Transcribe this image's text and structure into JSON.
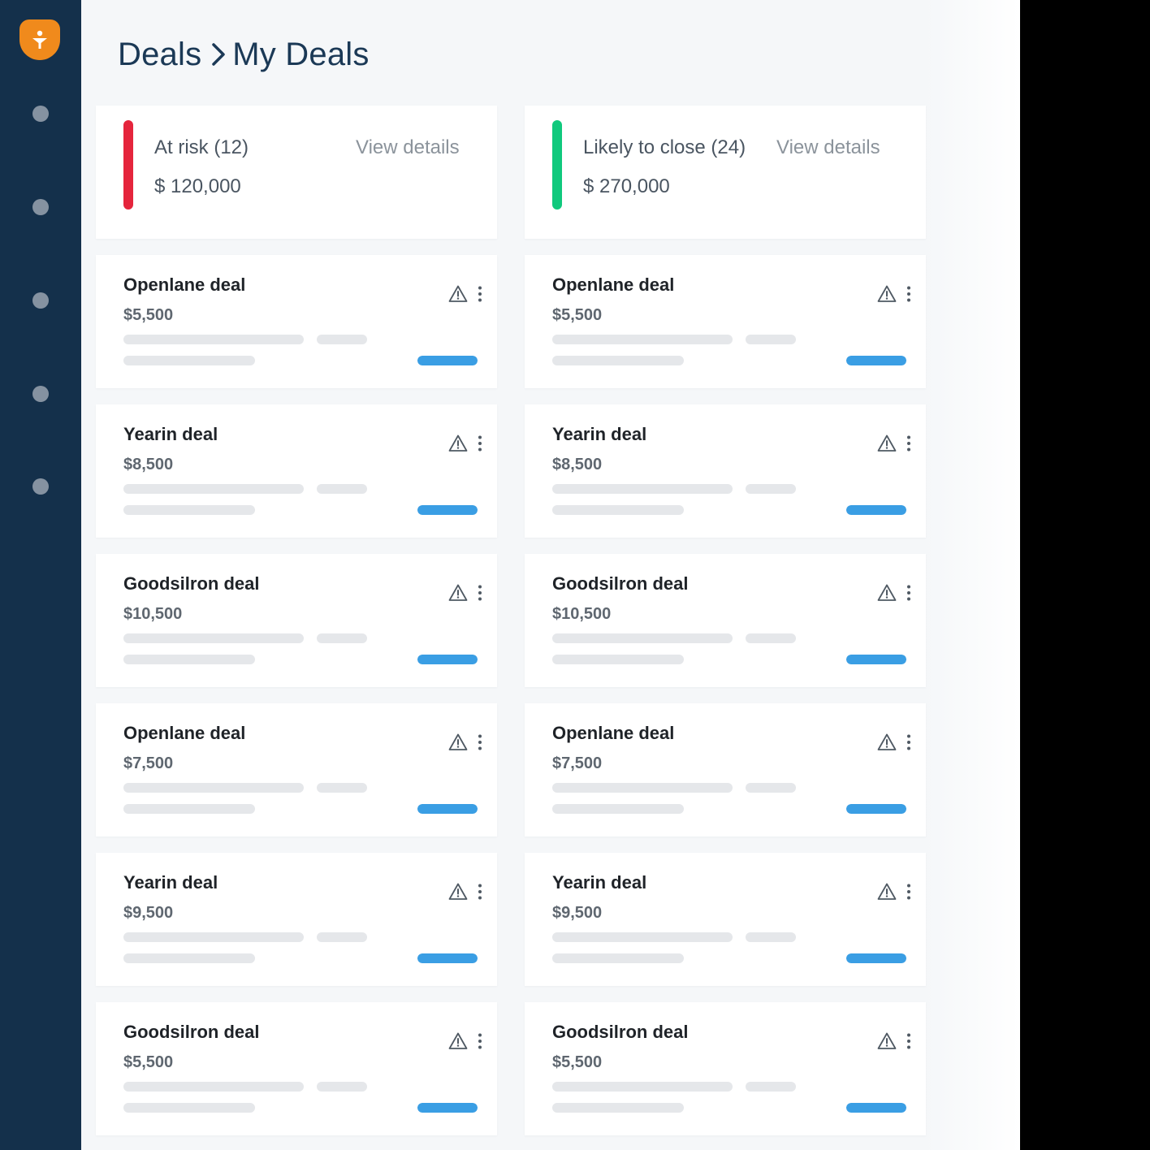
{
  "sidebar": {
    "nav_items": [
      "nav-item-1",
      "nav-item-2",
      "nav-item-3",
      "nav-item-4",
      "nav-item-5"
    ]
  },
  "breadcrumb": {
    "parent": "Deals",
    "current": "My Deals"
  },
  "colors": {
    "sidebar": "#14304b",
    "at_risk": "#e5253c",
    "likely": "#10c97d",
    "progress": "#3a9ee4",
    "logo": "#f08a1c"
  },
  "summaries": [
    {
      "title": "At risk (12)",
      "amount": "$ 120,000",
      "link": "View details"
    },
    {
      "title": "Likely to close (24)",
      "amount": "$ 270,000",
      "link": "View details"
    }
  ],
  "columns": [
    {
      "deals": [
        {
          "name": "Openlane deal",
          "amount": "$5,500",
          "progress": 1.0
        },
        {
          "name": "Yearin deal",
          "amount": "$8,500",
          "progress": 1.0
        },
        {
          "name": "Goodsilron deal",
          "amount": "$10,500",
          "progress": 1.0
        },
        {
          "name": "Openlane deal",
          "amount": "$7,500",
          "progress": 1.0
        },
        {
          "name": "Yearin deal",
          "amount": "$9,500",
          "progress": 1.0
        },
        {
          "name": "Goodsilron deal",
          "amount": "$5,500",
          "progress": 1.0
        }
      ]
    },
    {
      "deals": [
        {
          "name": "Openlane deal",
          "amount": "$5,500",
          "progress": 1.0
        },
        {
          "name": "Yearin deal",
          "amount": "$8,500",
          "progress": 1.0
        },
        {
          "name": "Goodsilron deal",
          "amount": "$10,500",
          "progress": 1.0
        },
        {
          "name": "Openlane deal",
          "amount": "$7,500",
          "progress": 1.0
        },
        {
          "name": "Yearin deal",
          "amount": "$9,500",
          "progress": 1.0
        },
        {
          "name": "Goodsilron deal",
          "amount": "$5,500",
          "progress": 1.0
        }
      ]
    }
  ],
  "icons": {
    "warning": "warning-icon",
    "more": "more-vertical-icon",
    "logo": "brand-logo-icon"
  }
}
